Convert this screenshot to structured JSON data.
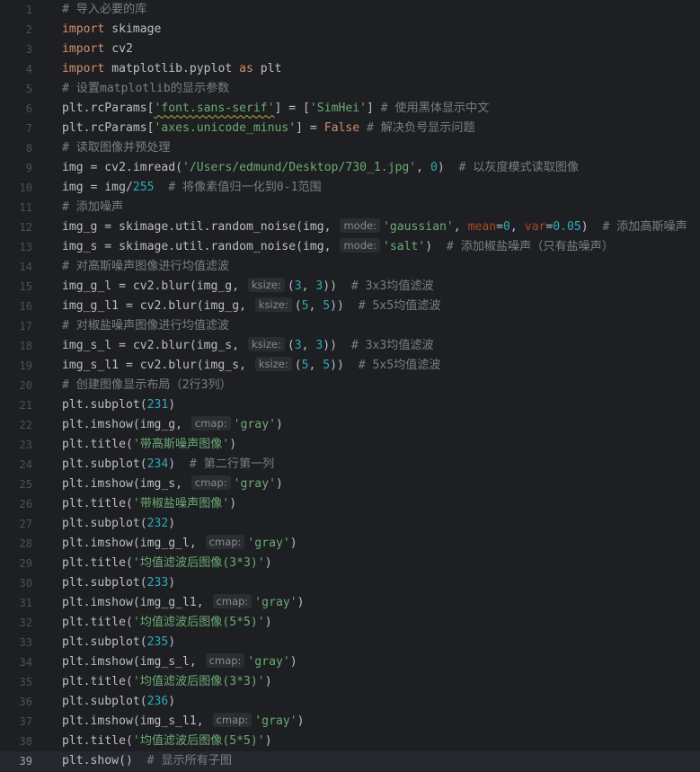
{
  "editor": {
    "current_line": 39,
    "lines": [
      [
        {
          "t": "# 导入必要的库",
          "c": "com"
        }
      ],
      [
        {
          "t": "import",
          "c": "kw"
        },
        {
          "t": " skimage",
          "c": "plain"
        }
      ],
      [
        {
          "t": "import",
          "c": "kw"
        },
        {
          "t": " cv2",
          "c": "plain"
        }
      ],
      [
        {
          "t": "import",
          "c": "kw"
        },
        {
          "t": " matplotlib.pyplot ",
          "c": "plain"
        },
        {
          "t": "as",
          "c": "kw"
        },
        {
          "t": " plt",
          "c": "plain"
        }
      ],
      [
        {
          "t": "# 设置matplotlib的显示参数",
          "c": "com"
        }
      ],
      [
        {
          "t": "plt.rcParams[",
          "c": "plain"
        },
        {
          "t": "'font.sans-serif'",
          "c": "str",
          "err": true
        },
        {
          "t": "] = [",
          "c": "plain"
        },
        {
          "t": "'SimHei'",
          "c": "str"
        },
        {
          "t": "] ",
          "c": "plain"
        },
        {
          "t": "# 使用黑体显示中文",
          "c": "com"
        }
      ],
      [
        {
          "t": "plt.rcParams[",
          "c": "plain"
        },
        {
          "t": "'axes.unicode_minus'",
          "c": "str"
        },
        {
          "t": "] = ",
          "c": "plain"
        },
        {
          "t": "False",
          "c": "kw"
        },
        {
          "t": " ",
          "c": "plain"
        },
        {
          "t": "# 解决负号显示问题",
          "c": "com"
        }
      ],
      [
        {
          "t": "# 读取图像并预处理",
          "c": "com"
        }
      ],
      [
        {
          "t": "img = cv2.imread(",
          "c": "plain"
        },
        {
          "t": "'/Users/edmund/Desktop/730_1.jpg'",
          "c": "str"
        },
        {
          "t": ", ",
          "c": "plain"
        },
        {
          "t": "0",
          "c": "num"
        },
        {
          "t": ")  ",
          "c": "plain"
        },
        {
          "t": "# 以灰度模式读取图像",
          "c": "com"
        }
      ],
      [
        {
          "t": "img = img/",
          "c": "plain"
        },
        {
          "t": "255",
          "c": "num"
        },
        {
          "t": "  ",
          "c": "plain"
        },
        {
          "t": "# 将像素值归一化到0-1范围",
          "c": "com"
        }
      ],
      [
        {
          "t": "# 添加噪声",
          "c": "com"
        }
      ],
      [
        {
          "t": "img_g = skimage.util.random_noise(img, ",
          "c": "plain"
        },
        {
          "h": "mode:"
        },
        {
          "t": "'gaussian'",
          "c": "str"
        },
        {
          "t": ", ",
          "c": "plain"
        },
        {
          "t": "mean",
          "c": "kwarg"
        },
        {
          "t": "=",
          "c": "plain"
        },
        {
          "t": "0",
          "c": "num"
        },
        {
          "t": ", ",
          "c": "plain"
        },
        {
          "t": "var",
          "c": "kwarg"
        },
        {
          "t": "=",
          "c": "plain"
        },
        {
          "t": "0.05",
          "c": "num"
        },
        {
          "t": ")  ",
          "c": "plain"
        },
        {
          "t": "# 添加高斯噪声",
          "c": "com"
        }
      ],
      [
        {
          "t": "img_s = skimage.util.random_noise(img, ",
          "c": "plain"
        },
        {
          "h": "mode:"
        },
        {
          "t": "'salt'",
          "c": "str"
        },
        {
          "t": ")  ",
          "c": "plain"
        },
        {
          "t": "# 添加椒盐噪声（只有盐噪声）",
          "c": "com"
        }
      ],
      [
        {
          "t": "# 对高斯噪声图像进行均值滤波",
          "c": "com"
        }
      ],
      [
        {
          "t": "img_g_l = cv2.blur(img_g, ",
          "c": "plain"
        },
        {
          "h": "ksize:"
        },
        {
          "t": "(",
          "c": "plain"
        },
        {
          "t": "3",
          "c": "num"
        },
        {
          "t": ", ",
          "c": "plain"
        },
        {
          "t": "3",
          "c": "num"
        },
        {
          "t": "))  ",
          "c": "plain"
        },
        {
          "t": "# 3x3均值滤波",
          "c": "com"
        }
      ],
      [
        {
          "t": "img_g_l1 = cv2.blur(img_g, ",
          "c": "plain"
        },
        {
          "h": "ksize:"
        },
        {
          "t": "(",
          "c": "plain"
        },
        {
          "t": "5",
          "c": "num"
        },
        {
          "t": ", ",
          "c": "plain"
        },
        {
          "t": "5",
          "c": "num"
        },
        {
          "t": "))  ",
          "c": "plain"
        },
        {
          "t": "# 5x5均值滤波",
          "c": "com"
        }
      ],
      [
        {
          "t": "# 对椒盐噪声图像进行均值滤波",
          "c": "com"
        }
      ],
      [
        {
          "t": "img_s_l = cv2.blur(img_s, ",
          "c": "plain"
        },
        {
          "h": "ksize:"
        },
        {
          "t": "(",
          "c": "plain"
        },
        {
          "t": "3",
          "c": "num"
        },
        {
          "t": ", ",
          "c": "plain"
        },
        {
          "t": "3",
          "c": "num"
        },
        {
          "t": "))  ",
          "c": "plain"
        },
        {
          "t": "# 3x3均值滤波",
          "c": "com"
        }
      ],
      [
        {
          "t": "img_s_l1 = cv2.blur(img_s, ",
          "c": "plain"
        },
        {
          "h": "ksize:"
        },
        {
          "t": "(",
          "c": "plain"
        },
        {
          "t": "5",
          "c": "num"
        },
        {
          "t": ", ",
          "c": "plain"
        },
        {
          "t": "5",
          "c": "num"
        },
        {
          "t": "))  ",
          "c": "plain"
        },
        {
          "t": "# 5x5均值滤波",
          "c": "com"
        }
      ],
      [
        {
          "t": "# 创建图像显示布局（2行3列）",
          "c": "com"
        }
      ],
      [
        {
          "t": "plt.subplot(",
          "c": "plain"
        },
        {
          "t": "231",
          "c": "num"
        },
        {
          "t": ")",
          "c": "plain"
        }
      ],
      [
        {
          "t": "plt.imshow(img_g, ",
          "c": "plain"
        },
        {
          "h": "cmap:"
        },
        {
          "t": "'gray'",
          "c": "str"
        },
        {
          "t": ")",
          "c": "plain"
        }
      ],
      [
        {
          "t": "plt.title(",
          "c": "plain"
        },
        {
          "t": "'带高斯噪声图像'",
          "c": "str"
        },
        {
          "t": ")",
          "c": "plain"
        }
      ],
      [
        {
          "t": "plt.subplot(",
          "c": "plain"
        },
        {
          "t": "234",
          "c": "num"
        },
        {
          "t": ")  ",
          "c": "plain"
        },
        {
          "t": "# 第二行第一列",
          "c": "com"
        }
      ],
      [
        {
          "t": "plt.imshow(img_s, ",
          "c": "plain"
        },
        {
          "h": "cmap:"
        },
        {
          "t": "'gray'",
          "c": "str"
        },
        {
          "t": ")",
          "c": "plain"
        }
      ],
      [
        {
          "t": "plt.title(",
          "c": "plain"
        },
        {
          "t": "'带椒盐噪声图像'",
          "c": "str"
        },
        {
          "t": ")",
          "c": "plain"
        }
      ],
      [
        {
          "t": "plt.subplot(",
          "c": "plain"
        },
        {
          "t": "232",
          "c": "num"
        },
        {
          "t": ")",
          "c": "plain"
        }
      ],
      [
        {
          "t": "plt.imshow(img_g_l, ",
          "c": "plain"
        },
        {
          "h": "cmap:"
        },
        {
          "t": "'gray'",
          "c": "str"
        },
        {
          "t": ")",
          "c": "plain"
        }
      ],
      [
        {
          "t": "plt.title(",
          "c": "plain"
        },
        {
          "t": "'均值滤波后图像(3*3)'",
          "c": "str"
        },
        {
          "t": ")",
          "c": "plain"
        }
      ],
      [
        {
          "t": "plt.subplot(",
          "c": "plain"
        },
        {
          "t": "233",
          "c": "num"
        },
        {
          "t": ")",
          "c": "plain"
        }
      ],
      [
        {
          "t": "plt.imshow(img_g_l1, ",
          "c": "plain"
        },
        {
          "h": "cmap:"
        },
        {
          "t": "'gray'",
          "c": "str"
        },
        {
          "t": ")",
          "c": "plain"
        }
      ],
      [
        {
          "t": "plt.title(",
          "c": "plain"
        },
        {
          "t": "'均值滤波后图像(5*5)'",
          "c": "str"
        },
        {
          "t": ")",
          "c": "plain"
        }
      ],
      [
        {
          "t": "plt.subplot(",
          "c": "plain"
        },
        {
          "t": "235",
          "c": "num"
        },
        {
          "t": ")",
          "c": "plain"
        }
      ],
      [
        {
          "t": "plt.imshow(img_s_l, ",
          "c": "plain"
        },
        {
          "h": "cmap:"
        },
        {
          "t": "'gray'",
          "c": "str"
        },
        {
          "t": ")",
          "c": "plain"
        }
      ],
      [
        {
          "t": "plt.title(",
          "c": "plain"
        },
        {
          "t": "'均值滤波后图像(3*3)'",
          "c": "str"
        },
        {
          "t": ")",
          "c": "plain"
        }
      ],
      [
        {
          "t": "plt.subplot(",
          "c": "plain"
        },
        {
          "t": "236",
          "c": "num"
        },
        {
          "t": ")",
          "c": "plain"
        }
      ],
      [
        {
          "t": "plt.imshow(img_s_l1, ",
          "c": "plain"
        },
        {
          "h": "cmap:"
        },
        {
          "t": "'gray'",
          "c": "str"
        },
        {
          "t": ")",
          "c": "plain"
        }
      ],
      [
        {
          "t": "plt.title(",
          "c": "plain"
        },
        {
          "t": "'均值滤波后图像(5*5)'",
          "c": "str"
        },
        {
          "t": ")",
          "c": "plain"
        }
      ],
      [
        {
          "t": "plt.show()",
          "c": "plain"
        },
        {
          "t": "  ",
          "c": "plain"
        },
        {
          "t": "# 显示所有子图",
          "c": "com"
        }
      ]
    ]
  }
}
